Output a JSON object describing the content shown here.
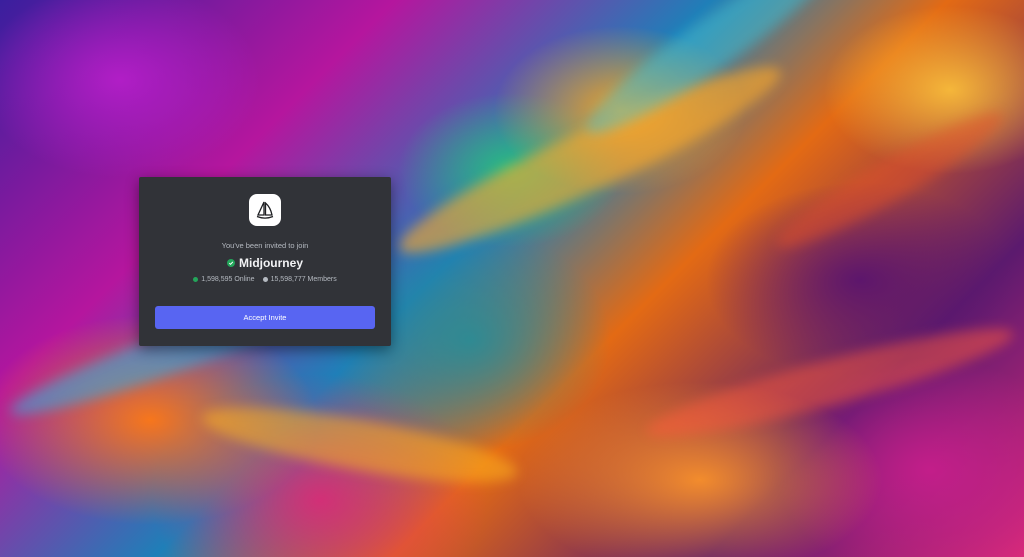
{
  "invite": {
    "heading": "You've been invited to join",
    "server_name": "Midjourney",
    "online_count": "1,598,595 Online",
    "member_count": "15,598,777 Members",
    "accept_label": "Accept Invite"
  },
  "icons": {
    "server": "sailboat-logo-icon",
    "verified": "verified-check-icon",
    "online": "online-dot-icon",
    "members": "members-dot-icon"
  },
  "colors": {
    "card_bg": "#313338",
    "button_bg": "#5865f2",
    "online_dot": "#23a55a",
    "members_dot": "#b5bac1",
    "verified": "#23a55a"
  }
}
